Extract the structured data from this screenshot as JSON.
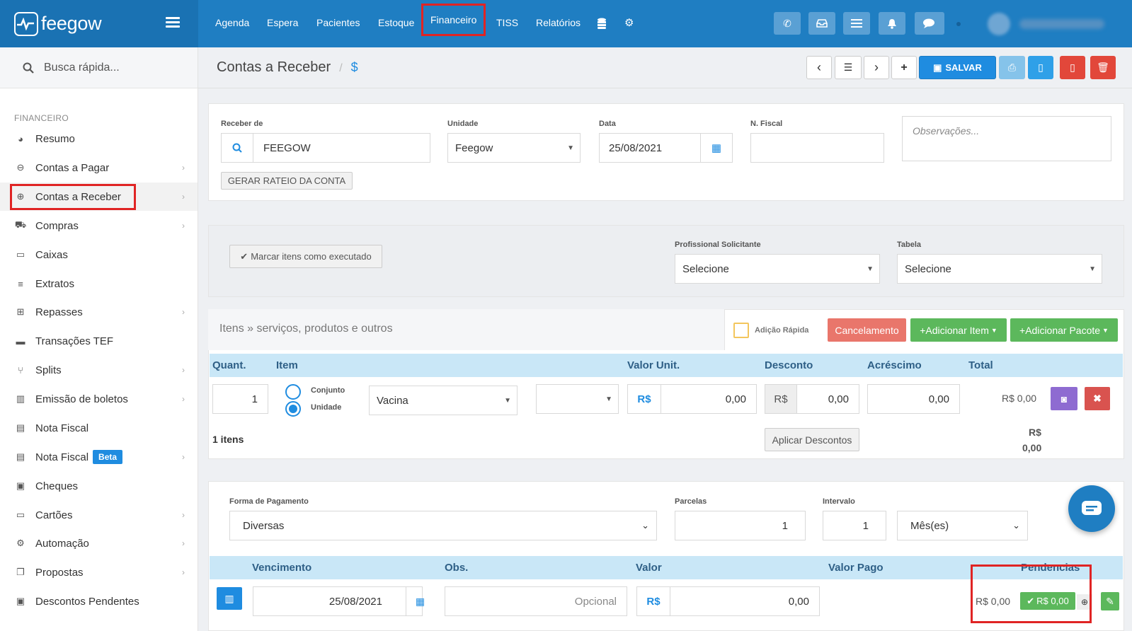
{
  "app": {
    "name": "feegow"
  },
  "nav": {
    "items": [
      "Agenda",
      "Espera",
      "Pacientes",
      "Estoque",
      "Financeiro",
      "TISS",
      "Relatórios"
    ],
    "active": "Financeiro"
  },
  "search": {
    "placeholder": "Busca rápida..."
  },
  "sidebar": {
    "section": "FINANCEIRO",
    "items": [
      {
        "label": "Resumo",
        "icon": "pie-chart-icon"
      },
      {
        "label": "Contas a Pagar",
        "icon": "minus-circle-icon"
      },
      {
        "label": "Contas a Receber",
        "icon": "plus-circle-icon"
      },
      {
        "label": "Compras",
        "icon": "cart-icon"
      },
      {
        "label": "Caixas",
        "icon": "inbox-icon"
      },
      {
        "label": "Extratos",
        "icon": "list-icon"
      },
      {
        "label": "Repasses",
        "icon": "sitemap-icon"
      },
      {
        "label": "Transações TEF",
        "icon": "credit-card-icon"
      },
      {
        "label": "Splits",
        "icon": "split-icon"
      },
      {
        "label": "Emissão de boletos",
        "icon": "barcode-icon"
      },
      {
        "label": "Nota Fiscal",
        "icon": "document-icon"
      },
      {
        "label": "Nota Fiscal",
        "icon": "document-icon",
        "badge": "Beta"
      },
      {
        "label": "Cheques",
        "icon": "check-icon"
      },
      {
        "label": "Cartões",
        "icon": "card-icon"
      },
      {
        "label": "Automação",
        "icon": "gears-icon"
      },
      {
        "label": "Propostas",
        "icon": "copy-icon"
      },
      {
        "label": "Descontos Pendentes",
        "icon": "money-icon"
      }
    ]
  },
  "page": {
    "title": "Contas a Receber",
    "currency_symbol": "$",
    "save_label": "SALVAR"
  },
  "form": {
    "receber_label": "Receber de",
    "receber_value": "FEEGOW",
    "unidade_label": "Unidade",
    "unidade_value": "Feegow",
    "data_label": "Data",
    "data_value": "25/08/2021",
    "nfiscal_label": "N. Fiscal",
    "nfiscal_value": "",
    "obs_placeholder": "Observações...",
    "rateio_btn": "GERAR RATEIO DA CONTA"
  },
  "exec": {
    "mark_btn": "Marcar itens como executado",
    "prof_label": "Profissional Solicitante",
    "prof_value": "Selecione",
    "tabela_label": "Tabela",
    "tabela_value": "Selecione"
  },
  "items": {
    "title": "Itens » serviços, produtos e outros",
    "adicao_rapida": "Adição Rápida",
    "cancel_btn": "Cancelamento",
    "add_item_btn": "Adicionar Item",
    "add_pkg_btn": "Adicionar Pacote",
    "headers": {
      "quant": "Quant.",
      "item": "Item",
      "valor_unit": "Valor Unit.",
      "desconto": "Desconto",
      "acrescimo": "Acréscimo",
      "total": "Total"
    },
    "row": {
      "quant": "1",
      "opt1": "Conjunto",
      "opt2": "Unidade",
      "item": "Vacina",
      "currency": "R$",
      "valor": "0,00",
      "desconto_currency": "R$",
      "desconto": "0,00",
      "acrescimo": "0,00",
      "total": "R$ 0,00"
    },
    "count": "1 itens",
    "apply_btn": "Aplicar Descontos",
    "sum_currency": "R$",
    "sum_value": "0,00"
  },
  "payment": {
    "forma_label": "Forma de Pagamento",
    "forma_value": "Diversas",
    "parcelas_label": "Parcelas",
    "parcelas_value": "1",
    "intervalo_label": "Intervalo",
    "intervalo_value": "1",
    "periodo_value": "Mês(es)",
    "headers": {
      "venc": "Vencimento",
      "obs": "Obs.",
      "valor": "Valor",
      "pago": "Valor Pago",
      "pend": "Pendencias"
    },
    "row": {
      "venc": "25/08/2021",
      "obs_placeholder": "Opcional",
      "currency": "R$",
      "valor": "0,00",
      "pago": "R$ 0,00",
      "pago_badge": "R$ 0,00"
    }
  },
  "colors": {
    "primary": "#1f7ec2",
    "highlight": "#e02424",
    "green": "#5cb85c",
    "purple": "#8e6bd1",
    "red": "#d9534f"
  }
}
